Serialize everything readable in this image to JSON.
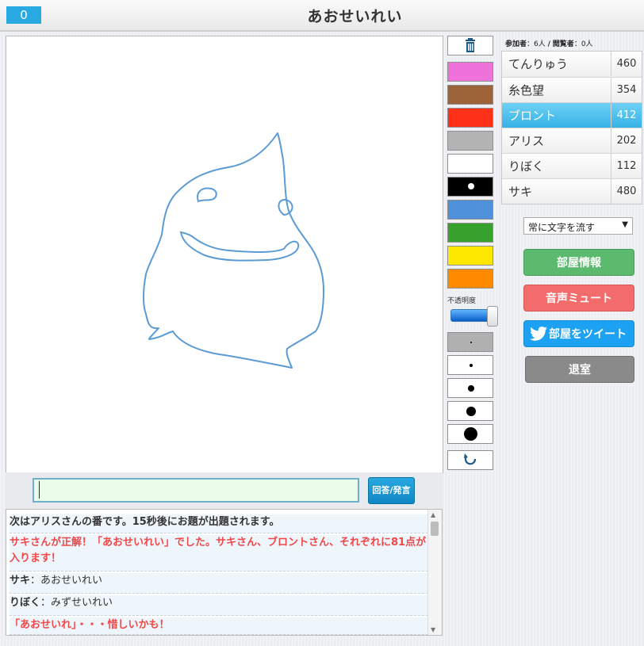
{
  "header": {
    "score": "0",
    "answer": "あおせいれい"
  },
  "tools": {
    "palette": [
      {
        "name": "pink",
        "color": "#ee72d9"
      },
      {
        "name": "brown",
        "color": "#9c6238"
      },
      {
        "name": "red",
        "color": "#ff3219"
      },
      {
        "name": "gray",
        "color": "#b3b3b3"
      },
      {
        "name": "white",
        "color": "#ffffff"
      },
      {
        "name": "black",
        "color": "#000000"
      },
      {
        "name": "blue",
        "color": "#4e90d9"
      },
      {
        "name": "green",
        "color": "#36a12d"
      },
      {
        "name": "yellow",
        "color": "#ffe800"
      },
      {
        "name": "orange",
        "color": "#ff8a00"
      }
    ],
    "opacity_label": "不透明度",
    "opacity_value": 1.0,
    "trash_icon": "trash-icon",
    "undo_icon": "undo-icon"
  },
  "sidebar": {
    "participants_label": "参加者",
    "participants_count": "：6人",
    "separator": "/",
    "viewers_label": "閲覧者",
    "viewers_count": "：0人",
    "players": [
      {
        "name": "てんりゅう",
        "score": "460"
      },
      {
        "name": "糸色望",
        "score": "354"
      },
      {
        "name": "ブロント",
        "score": "412",
        "active": true
      },
      {
        "name": "アリス",
        "score": "202"
      },
      {
        "name": "りぼく",
        "score": "112"
      },
      {
        "name": "サキ",
        "score": "480"
      }
    ],
    "flow_select": "常に文字を流す",
    "buttons": {
      "room_info": "部屋情報",
      "mute": "音声ミュート",
      "tweet": "部屋をツイート",
      "exit": "退室"
    }
  },
  "chat": {
    "input_value": "",
    "send_label": "回答/発言",
    "messages": {
      "m1": "次はアリスさんの番です。15秒後にお題が出題されます。",
      "m2": "サキさんが正解！「あおせいれい」でした。サキさん、ブロントさん、それぞれに81点が入ります！",
      "m3_who": "サキ",
      "m3_text": "：あおせいれい",
      "m4_who": "りぼく",
      "m4_text": "：みずせいれい",
      "m5": "「あおせいれ」・・・惜しいかも！"
    }
  },
  "colors": {
    "accent": "#29a9e1",
    "active_row": "#35b2e6",
    "stroke": "#5b9bd5",
    "correct_text": "#f04848"
  }
}
